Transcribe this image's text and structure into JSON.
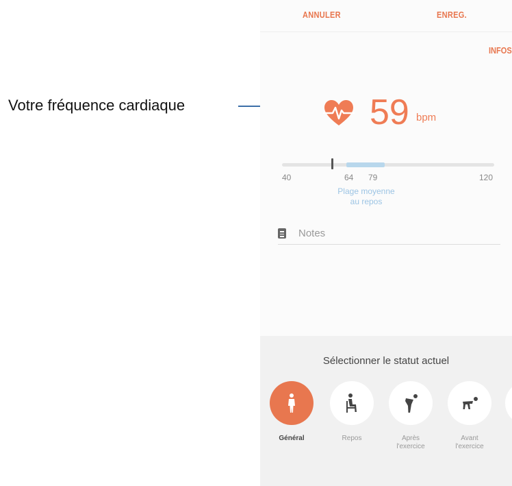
{
  "annotation": {
    "label": "Votre fréquence cardiaque"
  },
  "toolbar": {
    "cancel_label": "ANNULER",
    "save_label": "ENREG.",
    "info_label": "INFOS"
  },
  "heart_rate": {
    "value": "59",
    "unit": "bpm"
  },
  "range_bar": {
    "min_label": "40",
    "range_low_label": "64",
    "range_high_label": "79",
    "max_label": "120",
    "caption_line1": "Plage moyenne",
    "caption_line2": "au repos",
    "current_value": 59
  },
  "notes": {
    "placeholder": "Notes"
  },
  "status_sheet": {
    "title": "Sélectionner le statut actuel",
    "options": [
      {
        "label": "Général",
        "label2": "",
        "icon": "standing-person-icon",
        "selected": true
      },
      {
        "label": "Repos",
        "label2": "",
        "icon": "sitting-person-icon",
        "selected": false
      },
      {
        "label": "Après",
        "label2": "l'exercice",
        "icon": "bent-over-person-icon",
        "selected": false
      },
      {
        "label": "Avant",
        "label2": "l'exercice",
        "icon": "stretching-person-icon",
        "selected": false
      }
    ]
  },
  "colors": {
    "accent": "#e8774f",
    "range_fill": "#b8d7ec",
    "leader_line": "#3c6fa8"
  }
}
